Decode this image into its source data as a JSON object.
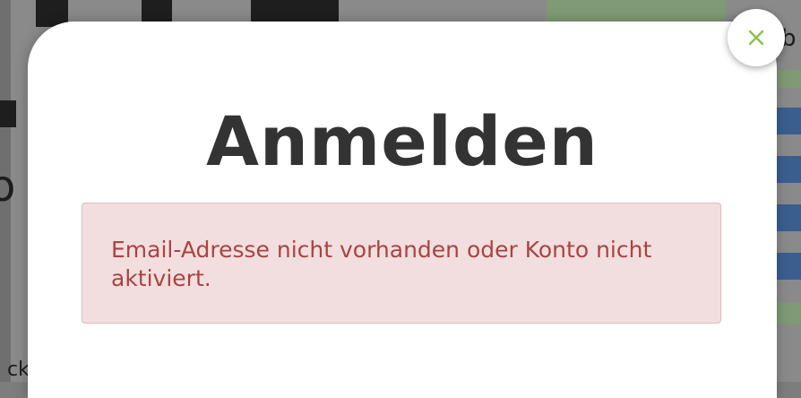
{
  "background": {
    "edge_letters": [
      "b",
      "ck",
      "o"
    ]
  },
  "modal": {
    "title": "Anmelden",
    "alert": {
      "message": "Email-Adresse nicht vorhanden oder Konto nicht aktiviert.",
      "color": "#a94442",
      "background": "#f2dede"
    },
    "close_icon": "close-icon"
  }
}
